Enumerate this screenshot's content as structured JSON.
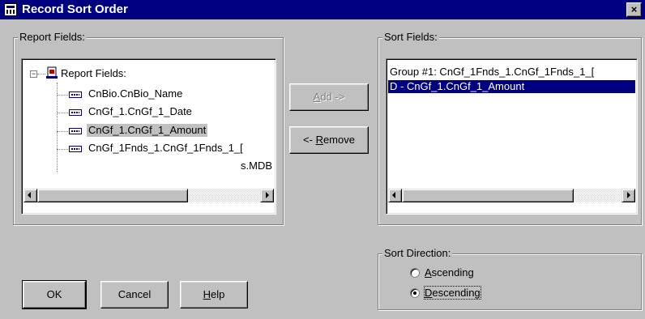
{
  "window": {
    "title": "Record Sort Order",
    "close_glyph": "×"
  },
  "report_fields": {
    "group_label": "Report Fields:",
    "tree_root": "Report Fields:",
    "items": [
      "CnBio.CnBio_Name",
      "CnGf_1.CnGf_1_Date",
      "CnGf_1.CnGf_1_Amount",
      "CnGf_1Fnds_1.CnGf_1Fnds_1_["
    ],
    "selected_index": 2,
    "overflow_text": "s.MDB"
  },
  "buttons": {
    "add": {
      "accel": "A",
      "rest": "dd ->"
    },
    "remove": {
      "pre": "<- ",
      "accel": "R",
      "rest": "emove"
    },
    "ok": "OK",
    "cancel": "Cancel",
    "help": {
      "accel": "H",
      "rest": "elp"
    }
  },
  "sort_fields": {
    "group_label": "Sort Fields:",
    "items": [
      "Group #1: CnGf_1Fnds_1.CnGf_1Fnds_1_[",
      "D - CnGf_1.CnGf_1_Amount"
    ],
    "selected_index": 1
  },
  "sort_direction": {
    "group_label": "Sort Direction:",
    "ascending": {
      "accel": "A",
      "rest": "scending"
    },
    "descending": {
      "accel": "D",
      "rest": "escending"
    },
    "selected": "descending"
  },
  "colors": {
    "face": "#c0c0c0",
    "title_bar": "#000080",
    "selection": "#000080"
  }
}
